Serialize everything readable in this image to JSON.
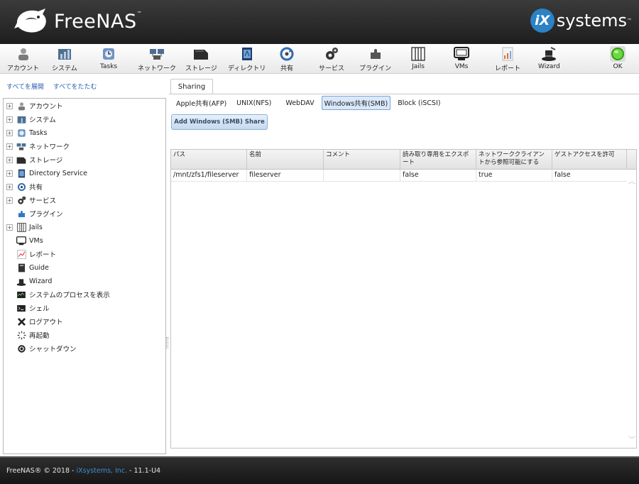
{
  "header": {
    "brand": "FreeNAS",
    "brand_tm": "™",
    "vendor_ix": "iX",
    "vendor_systems": "systems",
    "vendor_tm": "™"
  },
  "toolbar": {
    "items": [
      {
        "label": "アカウント",
        "icon": "account-icon"
      },
      {
        "label": "システム",
        "icon": "system-icon"
      },
      {
        "label": "Tasks",
        "icon": "tasks-icon"
      },
      {
        "label": "ネットワーク",
        "icon": "network-icon"
      },
      {
        "label": "ストレージ",
        "icon": "storage-icon"
      },
      {
        "label": "ディレクトリ",
        "icon": "directory-icon"
      },
      {
        "label": "共有",
        "icon": "sharing-icon"
      },
      {
        "label": "サービス",
        "icon": "services-icon"
      },
      {
        "label": "プラグイン",
        "icon": "plugins-icon"
      },
      {
        "label": "Jails",
        "icon": "jails-icon"
      },
      {
        "label": "VMs",
        "icon": "vms-icon"
      },
      {
        "label": "レポート",
        "icon": "reporting-icon"
      },
      {
        "label": "Wizard",
        "icon": "wizard-icon"
      },
      {
        "label": "OK",
        "icon": "alert-ok-icon"
      }
    ]
  },
  "tree": {
    "expand_all": "すべてを展開",
    "collapse_all": "すべてをたたむ",
    "items": [
      {
        "label": "アカウント",
        "expandable": true
      },
      {
        "label": "システム",
        "expandable": true
      },
      {
        "label": "Tasks",
        "expandable": true
      },
      {
        "label": "ネットワーク",
        "expandable": true
      },
      {
        "label": "ストレージ",
        "expandable": true
      },
      {
        "label": "Directory Service",
        "expandable": true
      },
      {
        "label": "共有",
        "expandable": true
      },
      {
        "label": "サービス",
        "expandable": true
      },
      {
        "label": "プラグイン",
        "expandable": false
      },
      {
        "label": "Jails",
        "expandable": true
      },
      {
        "label": "VMs",
        "expandable": false
      },
      {
        "label": "レポート",
        "expandable": false
      },
      {
        "label": "Guide",
        "expandable": false
      },
      {
        "label": "Wizard",
        "expandable": false
      },
      {
        "label": "システムのプロセスを表示",
        "expandable": false
      },
      {
        "label": "シェル",
        "expandable": false
      },
      {
        "label": "ログアウト",
        "expandable": false
      },
      {
        "label": "再起動",
        "expandable": false
      },
      {
        "label": "シャットダウン",
        "expandable": false
      }
    ]
  },
  "content": {
    "main_tab": "Sharing",
    "subtabs": [
      {
        "label": "Apple共有(AFP)",
        "active": false
      },
      {
        "label": "UNIX(NFS)",
        "active": false
      },
      {
        "label": "WebDAV",
        "active": false
      },
      {
        "label": "Windows共有(SMB)",
        "active": true
      },
      {
        "label": "Block (iSCSI)",
        "active": false
      }
    ],
    "add_button": "Add Windows (SMB) Share",
    "grid": {
      "columns": [
        "パス",
        "名前",
        "コメント",
        "読み取り専用をエクスポート",
        "ネットワーククライアントから参照可能にする",
        "ゲストアクセスを許可"
      ],
      "rows": [
        [
          "/mnt/zfs1/fileserver",
          "fileserver",
          "",
          "false",
          "true",
          "false"
        ]
      ]
    }
  },
  "footer": {
    "prefix": "FreeNAS® © 2018 - ",
    "company": "iXsystems, Inc.",
    "suffix": " - 11.1-U4"
  }
}
